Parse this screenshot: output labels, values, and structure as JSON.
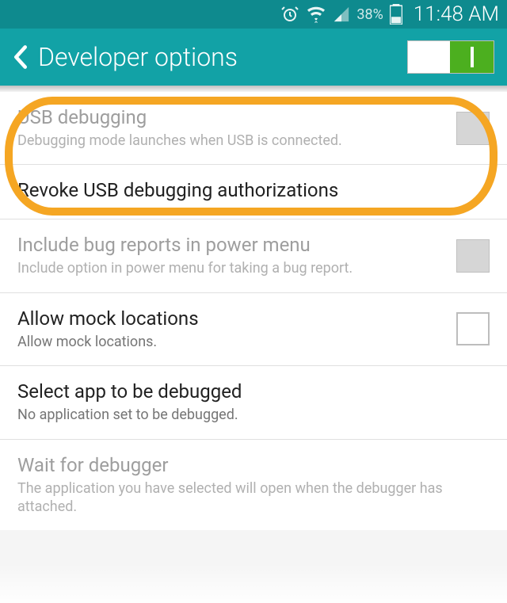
{
  "status_bar": {
    "battery_percent": "38%",
    "time": "11:48 AM"
  },
  "header": {
    "title": "Developer options",
    "master_switch_on": true
  },
  "rows": [
    {
      "id": "usb-debugging",
      "title": "USB debugging",
      "subtitle": "Debugging mode launches when USB is connected.",
      "disabled": true,
      "checkbox": "disabled"
    },
    {
      "id": "revoke-usb",
      "title": "Revoke USB debugging authorizations",
      "subtitle": null,
      "disabled": false,
      "checkbox": null
    },
    {
      "id": "bug-reports",
      "title": "Include bug reports in power menu",
      "subtitle": "Include option in power menu for taking a bug report.",
      "disabled": true,
      "checkbox": "disabled"
    },
    {
      "id": "mock-locations",
      "title": "Allow mock locations",
      "subtitle": "Allow mock locations.",
      "disabled": false,
      "checkbox": "unchecked"
    },
    {
      "id": "select-debug-app",
      "title": "Select app to be debugged",
      "subtitle": "No application set to be debugged.",
      "disabled": false,
      "checkbox": null
    },
    {
      "id": "wait-debugger",
      "title": "Wait for debugger",
      "subtitle": "The application you have selected will open when the debugger has attached.",
      "disabled": true,
      "checkbox": null
    }
  ]
}
